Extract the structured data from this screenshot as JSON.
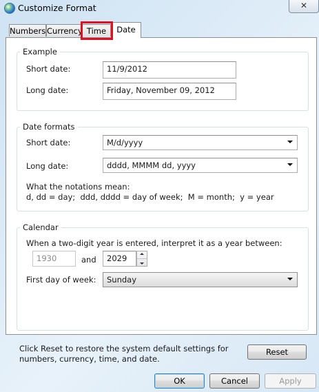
{
  "window": {
    "title": "Customize Format",
    "close_label": "✕"
  },
  "tabs": [
    {
      "label": "Numbers"
    },
    {
      "label": "Currency"
    },
    {
      "label": "Time"
    },
    {
      "label": "Date"
    }
  ],
  "example": {
    "legend": "Example",
    "short_label": "Short date:",
    "short_value": "11/9/2012",
    "long_label": "Long date:",
    "long_value": "Friday, November 09, 2012"
  },
  "date_formats": {
    "legend": "Date formats",
    "short_label": "Short date:",
    "short_value": "M/d/yyyy",
    "long_label": "Long date:",
    "long_value": "dddd, MMMM dd, yyyy",
    "notation_title": "What the notations mean:",
    "notation_text": "d, dd = day;  ddd, dddd = day of week;  M = month;  y = year"
  },
  "calendar": {
    "legend": "Calendar",
    "two_digit_text": "When a two-digit year is entered, interpret it as a year between:",
    "year_from": "1930",
    "and_label": "and",
    "year_to": "2029",
    "first_day_label": "First day of week:",
    "first_day_value": "Sunday"
  },
  "footer": {
    "reset_text_1": "Click Reset to restore the system default settings for",
    "reset_text_2": "numbers, currency, time, and date.",
    "reset_label": "Reset",
    "ok_label": "OK",
    "cancel_label": "Cancel",
    "apply_label": "Apply"
  }
}
